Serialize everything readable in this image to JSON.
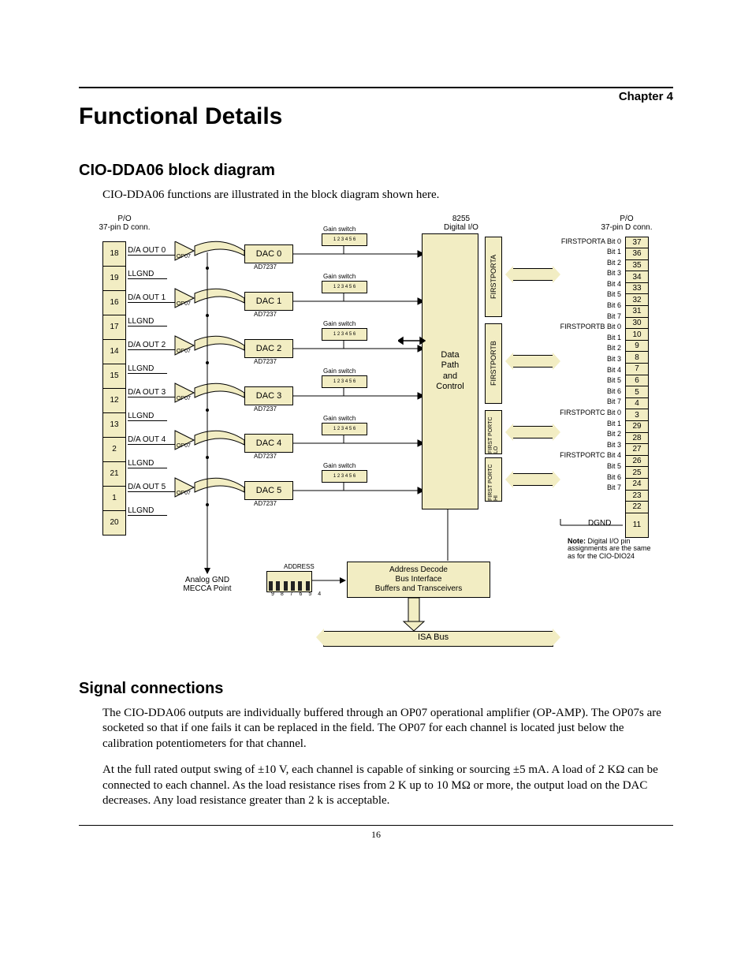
{
  "chapter": "Chapter 4",
  "title": "Functional Details",
  "section1": {
    "heading": "CIO-DDA06 block diagram",
    "intro": "CIO-DDA06 functions are illustrated in the block diagram shown here."
  },
  "section2": {
    "heading": "Signal connections",
    "p1": "The CIO-DDA06 outputs are individually buffered through an OP07 operational amplifier (OP-AMP). The OP07s are socketed so that if one fails it can be replaced in the field. The OP07 for each channel is located just below the calibration potentiometers for that channel.",
    "p2": "At the full rated output swing of ±10 V, each channel is capable of sinking or sourcing ±5 mA. A load of 2 KΩ can be connected to each channel. As the load resistance rises from 2 K up to 10 MΩ or more, the output load on the DAC decreases. Any load resistance greater than 2 k is acceptable."
  },
  "page_number": "16",
  "diagram": {
    "left_conn_header": [
      "P/O",
      "37-pin D conn."
    ],
    "right_conn_header": [
      "P/O",
      "37-pin D conn."
    ],
    "chip_header": [
      "8255",
      "Digital I/O"
    ],
    "left_pins": [
      "18",
      "19",
      "16",
      "17",
      "14",
      "15",
      "12",
      "13",
      "2",
      "21",
      "1",
      "20"
    ],
    "left_signals": [
      "D/A OUT 0",
      "LLGND",
      "D/A OUT 1",
      "LLGND",
      "D/A OUT 2",
      "LLGND",
      "D/A OUT 3",
      "LLGND",
      "D/A OUT 4",
      "LLGND",
      "D/A OUT 5",
      "LLGND"
    ],
    "op_label": "OP07",
    "dacs": [
      "DAC 0",
      "DAC 1",
      "DAC 2",
      "DAC 3",
      "DAC 4",
      "DAC 5"
    ],
    "dac_sub": "AD7237",
    "gain_switch": "Gain switch",
    "gain_switch_nums": "1 2 3 4 5 6",
    "center_block": "Data Path and Control",
    "ports": [
      "FIRSTPORTA",
      "FIRSTPORTB",
      "FIRST PORTC LO",
      "FIRST PORTC HI"
    ],
    "right_labels": [
      "FIRSTPORTA Bit 0",
      "Bit 1",
      "Bit 2",
      "Bit 3",
      "Bit 4",
      "Bit 5",
      "Bit 6",
      "Bit 7",
      "FIRSTPORTB Bit 0",
      "Bit 1",
      "Bit 2",
      "Bit 3",
      "Bit 4",
      "Bit 5",
      "Bit 6",
      "Bit 7",
      "FIRSTPORTC Bit 0",
      "Bit 1",
      "Bit 2",
      "Bit 3",
      "FIRSTPORTC Bit 4",
      "Bit 5",
      "Bit 6",
      "Bit 7"
    ],
    "right_pins": [
      "37",
      "36",
      "35",
      "34",
      "33",
      "32",
      "31",
      "30",
      "10",
      "9",
      "8",
      "7",
      "6",
      "5",
      "4",
      "3",
      "29",
      "28",
      "27",
      "26",
      "25",
      "24",
      "23",
      "22",
      "11"
    ],
    "dgnd": "DGND",
    "note": "Note: Digital I/O pin assignments are the same as for the CIO-DIO24",
    "mecca": "Analog GND MECCA Point",
    "address_label": "ADDRESS",
    "dip_nums": "9 8 7 6 5 4",
    "decode_block": "Address Decode Bus Interface Buffers and Transceivers",
    "isa_bus": "ISA Bus"
  }
}
